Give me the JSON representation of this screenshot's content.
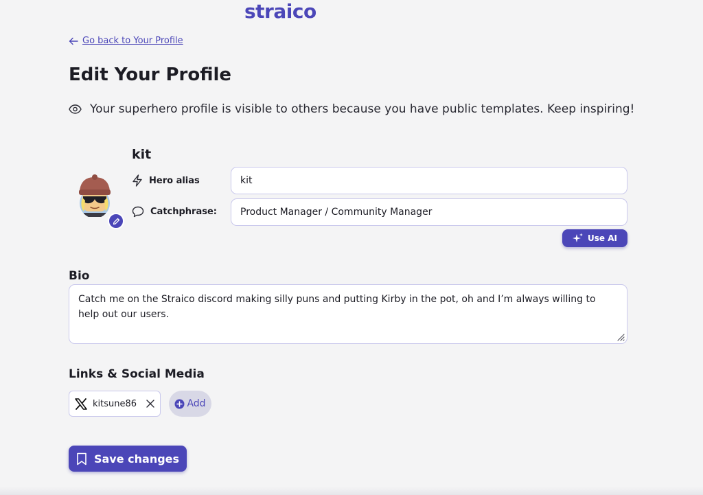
{
  "brand": {
    "logo_text": "straico",
    "accent": "#4b46b8"
  },
  "nav": {
    "back_label": "Go back to Your Profile",
    "back_icon": "arrow-left-icon"
  },
  "page": {
    "title": "Edit Your Profile",
    "visibility_notice": "Your superhero profile is visible to others because you have public templates. Keep inspiring!",
    "visibility_icon": "eye-icon"
  },
  "profile": {
    "username": "kit",
    "avatar_icon": "avatar-image",
    "avatar_edit_icon": "pencil-icon",
    "hero_alias": {
      "label": "Hero alias",
      "icon": "lightning-icon",
      "value": "kit"
    },
    "catchphrase": {
      "label": "Catchphrase:",
      "icon": "speech-bubble-icon",
      "value": "Product Manager / Community Manager"
    },
    "use_ai_label": "Use AI",
    "use_ai_icon": "sparkles-icon"
  },
  "bio": {
    "heading": "Bio",
    "value": "Catch me on the Straico discord making silly puns and putting Kirby in the pot, oh and I’m always willing to help out our users."
  },
  "links": {
    "heading": "Links & Social Media",
    "items": [
      {
        "platform_icon": "x-logo-icon",
        "handle": "kitsune86",
        "remove_icon": "close-icon"
      }
    ],
    "add_label": "Add",
    "add_icon": "plus-circle-icon"
  },
  "actions": {
    "save_label": "Save changes",
    "save_icon": "bookmark-icon"
  }
}
